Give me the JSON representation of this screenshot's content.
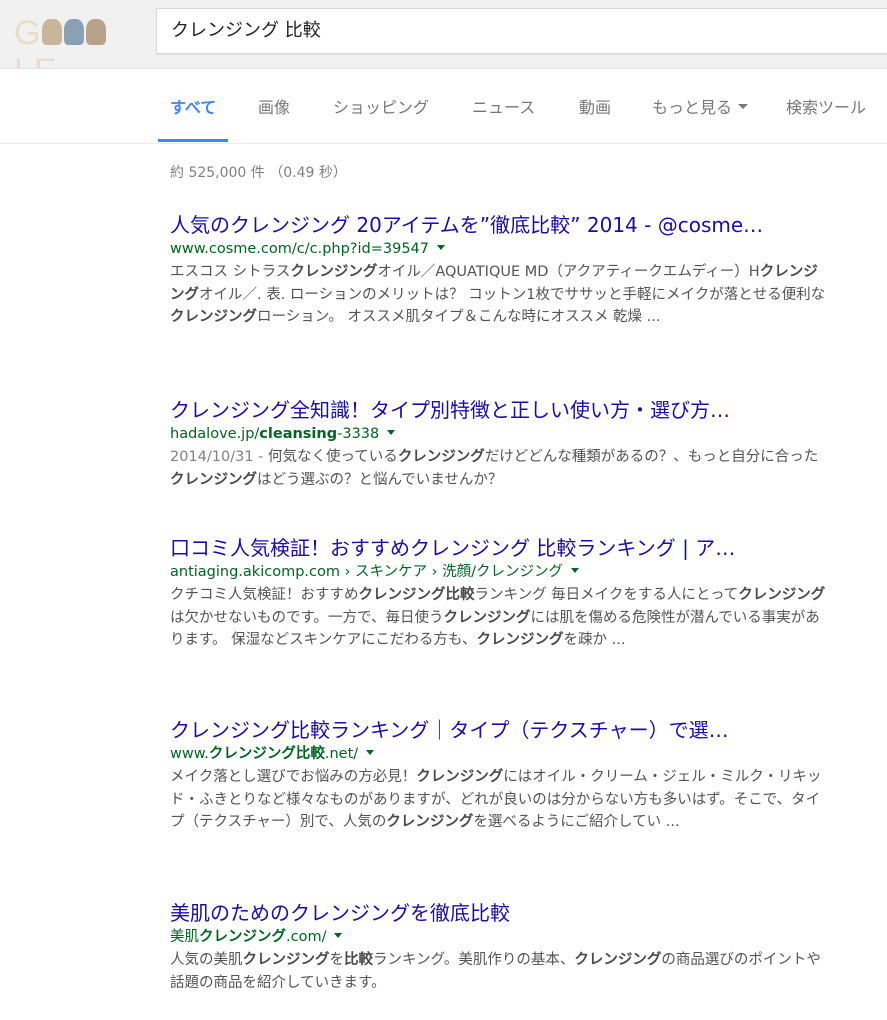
{
  "header": {
    "logo_text": "GOOGLE",
    "search_query": "クレンジング 比較"
  },
  "tabs": [
    {
      "label": "すべて"
    },
    {
      "label": "画像"
    },
    {
      "label": "ショッピング"
    },
    {
      "label": "ニュース"
    },
    {
      "label": "動画"
    },
    {
      "label": "もっと見る"
    },
    {
      "label": "検索ツール"
    }
  ],
  "stats": "約 525,000 件 （0.49 秒）",
  "results": [
    {
      "title": "人気のクレンジング 20アイテムを”徹底比較” 2014 - @cosme…",
      "url": [
        {
          "t": "www.cosme.com/c/c.php?id=39547",
          "b": false
        }
      ],
      "date": "",
      "snippet": [
        {
          "t": "エスコス シトラス",
          "b": false
        },
        {
          "t": "クレンジング",
          "b": true
        },
        {
          "t": "オイル／AQUATIQUE MD（アクアティークエムディー）H",
          "b": false
        },
        {
          "t": "クレンジング",
          "b": true
        },
        {
          "t": "オイル／. 表. ローションのメリットは？ コットン1枚でササッと手軽にメイクが落とせる便利な",
          "b": false
        },
        {
          "t": "クレンジング",
          "b": true
        },
        {
          "t": "ローション。 オススメ肌タイプ＆こんな時にオススメ 乾燥 ...",
          "b": false
        }
      ]
    },
    {
      "title": "クレンジング全知識！タイプ別特徴と正しい使い方・選び方…",
      "url": [
        {
          "t": "hadalove.jp/",
          "b": false
        },
        {
          "t": "cleansing",
          "b": true
        },
        {
          "t": "-3338",
          "b": false
        }
      ],
      "date": "2014/10/31 - ",
      "snippet": [
        {
          "t": "何気なく使っている",
          "b": false
        },
        {
          "t": "クレンジング",
          "b": true
        },
        {
          "t": "だけどどんな種類があるの？、もっと自分に合った",
          "b": false
        },
        {
          "t": "クレンジング",
          "b": true
        },
        {
          "t": "はどう選ぶの？と悩んでいませんか？",
          "b": false
        }
      ]
    },
    {
      "title": "口コミ人気検証！おすすめクレンジング 比較ランキング | ア…",
      "url": [
        {
          "t": "antiaging.akicomp.com › スキンケア › 洗顔/クレンジング",
          "b": false
        }
      ],
      "date": "",
      "snippet": [
        {
          "t": "クチコミ人気検証！おすすめ",
          "b": false
        },
        {
          "t": "クレンジング比較",
          "b": true
        },
        {
          "t": "ランキング 毎日メイクをする人にとって",
          "b": false
        },
        {
          "t": "クレンジング",
          "b": true
        },
        {
          "t": "は欠かせないものです。一方で、毎日使う",
          "b": false
        },
        {
          "t": "クレンジング",
          "b": true
        },
        {
          "t": "には肌を傷める危険性が潜んでいる事実があります。 保湿などスキンケアにこだわる方も、",
          "b": false
        },
        {
          "t": "クレンジング",
          "b": true
        },
        {
          "t": "を疎か ...",
          "b": false
        }
      ]
    },
    {
      "title": "クレンジング比較ランキング｜タイプ（テクスチャー）で選…",
      "url": [
        {
          "t": "www.",
          "b": false
        },
        {
          "t": "クレンジング比較",
          "b": true
        },
        {
          "t": ".net/",
          "b": false
        }
      ],
      "date": "",
      "snippet": [
        {
          "t": "メイク落とし選びでお悩みの方必見！",
          "b": false
        },
        {
          "t": "クレンジング",
          "b": true
        },
        {
          "t": "にはオイル・クリーム・ジェル・ミルク・リキッド・ふきとりなど様々なものがありますが、どれが良いのは分からない方も多いはず。そこで、タイプ（テクスチャー）別で、人気の",
          "b": false
        },
        {
          "t": "クレンジング",
          "b": true
        },
        {
          "t": "を選べるようにご紹介してい ...",
          "b": false
        }
      ]
    },
    {
      "title": "美肌のためのクレンジングを徹底比較",
      "url": [
        {
          "t": "美肌",
          "b": false
        },
        {
          "t": "クレンジング",
          "b": true
        },
        {
          "t": ".com/",
          "b": false
        }
      ],
      "date": "",
      "snippet": [
        {
          "t": "人気の美肌",
          "b": false
        },
        {
          "t": "クレンジング",
          "b": true
        },
        {
          "t": "を",
          "b": false
        },
        {
          "t": "比較",
          "b": true
        },
        {
          "t": "ランキング。美肌作りの基本、",
          "b": false
        },
        {
          "t": "クレンジング",
          "b": true
        },
        {
          "t": "の商品選びのポイントや話題の商品を紹介していきます。",
          "b": false
        }
      ]
    }
  ]
}
